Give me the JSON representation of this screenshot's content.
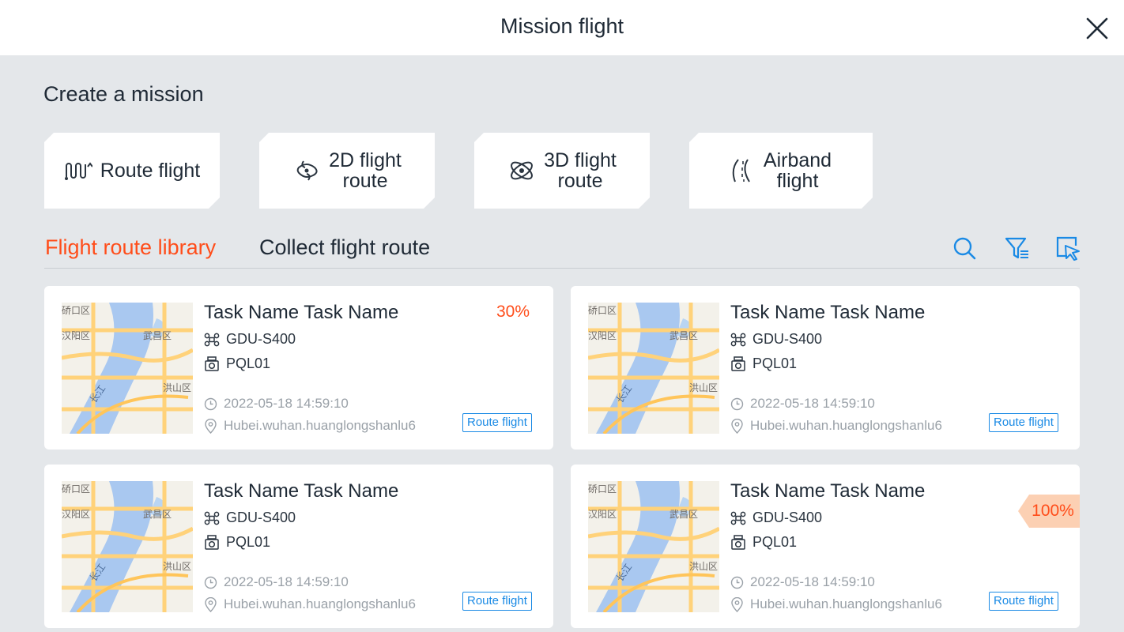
{
  "header": {
    "title": "Mission flight"
  },
  "create": {
    "title": "Create a mission",
    "modes": [
      {
        "label": "Route flight",
        "icon": "route-flight-icon"
      },
      {
        "label": "2D flight\nroute",
        "icon": "2d-flight-route-icon"
      },
      {
        "label": "3D flight\nroute",
        "icon": "3d-flight-route-icon"
      },
      {
        "label": "Airband\nflight",
        "icon": "airband-flight-icon"
      }
    ]
  },
  "tabs": [
    {
      "label": "Flight route library",
      "active": true
    },
    {
      "label": "Collect flight route",
      "active": false
    }
  ],
  "toolbar": {
    "icons": [
      "search-icon",
      "filter-icon",
      "select-icon"
    ]
  },
  "colors": {
    "accent": "#ff4d1a",
    "link": "#1a8ae5",
    "background": "#e4e7ea"
  },
  "missions": [
    {
      "name": "Task Name Task Name",
      "drone": "GDU-S400",
      "camera": "PQL01",
      "time": "2022-05-18 14:59:10",
      "location": "Hubei.wuhan.huanglongshanlu6",
      "type": "Route flight",
      "progress": "30%"
    },
    {
      "name": "Task Name Task Name",
      "drone": "GDU-S400",
      "camera": "PQL01",
      "time": "2022-05-18 14:59:10",
      "location": "Hubei.wuhan.huanglongshanlu6",
      "type": "Route flight",
      "progress": ""
    },
    {
      "name": "Task Name Task Name",
      "drone": "GDU-S400",
      "camera": "PQL01",
      "time": "2022-05-18 14:59:10",
      "location": "Hubei.wuhan.huanglongshanlu6",
      "type": "Route flight",
      "progress": ""
    },
    {
      "name": "Task Name Task Name",
      "drone": "GDU-S400",
      "camera": "PQL01",
      "time": "2022-05-18 14:59:10",
      "location": "Hubei.wuhan.huanglongshanlu6",
      "type": "Route flight",
      "progress": "100%"
    }
  ],
  "map_labels": [
    "硚口区",
    "汉阳区",
    "武昌区",
    "洪山区",
    "长江"
  ]
}
